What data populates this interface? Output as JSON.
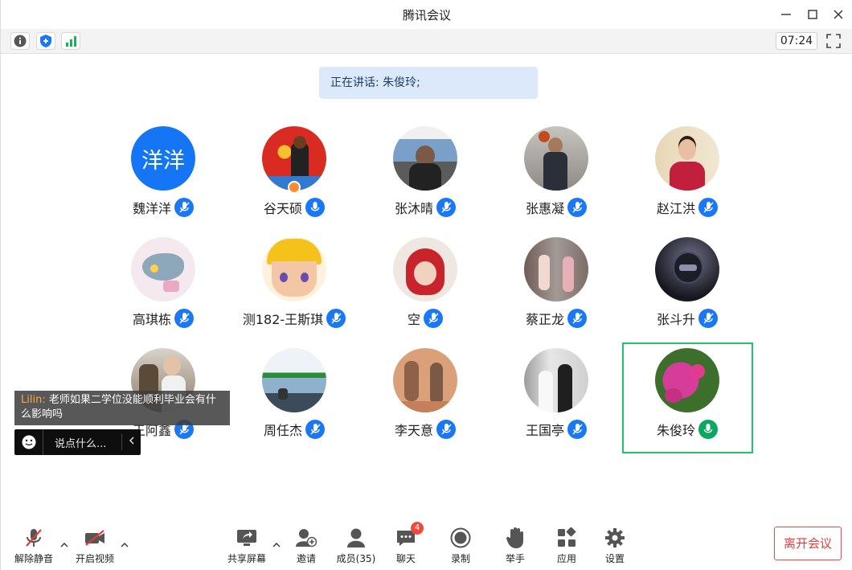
{
  "window": {
    "title": "腾讯会议"
  },
  "statusbar": {
    "timer": "07:24"
  },
  "speaking": {
    "text": "正在讲话: 朱俊玲;"
  },
  "participants": [
    {
      "name": "魏洋洋",
      "avatar_text": "洋洋"
    },
    {
      "name": "谷天硕"
    },
    {
      "name": "张沐晴"
    },
    {
      "name": "张惠凝"
    },
    {
      "name": "赵江洪"
    },
    {
      "name": "高琪栋"
    },
    {
      "name": "测182-王斯琪"
    },
    {
      "name": "空"
    },
    {
      "name": "蔡正龙"
    },
    {
      "name": "张斗升"
    },
    {
      "name": "王阿鑫"
    },
    {
      "name": "周任杰"
    },
    {
      "name": "李天意"
    },
    {
      "name": "王国亭"
    },
    {
      "name": "朱俊玲"
    }
  ],
  "chat": {
    "sender": "Lilin:",
    "message": "老师如果二学位没能顺利毕业会有什么影响吗",
    "input_placeholder": "说点什么..."
  },
  "toolbar": {
    "unmute": "解除静音",
    "start_video": "开启视频",
    "share_screen": "共享屏幕",
    "invite": "邀请",
    "members": "成员(35)",
    "chat": "聊天",
    "chat_badge": "4",
    "record": "录制",
    "raise_hand": "举手",
    "apps": "应用",
    "settings": "设置",
    "leave": "离开会议"
  },
  "colors": {
    "accent": "#1a78f5",
    "speaking_green": "#0aa860",
    "leave_red": "#e33c3c",
    "selected_border": "#23c26b"
  }
}
